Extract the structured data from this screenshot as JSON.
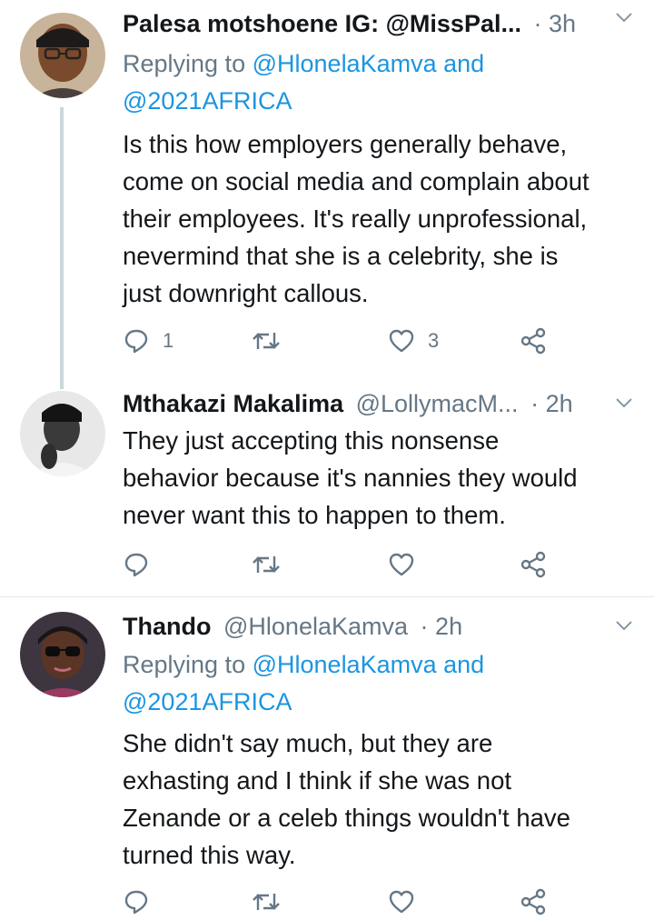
{
  "tweets": [
    {
      "name": "Palesa motshoene IG: @MissPal...",
      "handle": "",
      "separator": "·",
      "time": "3h",
      "replying_prefix": "Replying to",
      "replying_first": "@HlonelaKamva",
      "replying_and": "and",
      "replying_second": "@2021AFRICA",
      "text_lines": [
        "Is this how employers generally behave,",
        "come on social media and complain about",
        "their employees. It's really unprofessional,",
        "nevermind that she is a celebrity, she is",
        "just downright callous."
      ],
      "reply_count": "1",
      "retweet_count": "",
      "like_count": "3"
    },
    {
      "name": "Mthakazi Makalima",
      "handle": "@LollymacM...",
      "separator": "·",
      "time": "2h",
      "text_lines": [
        "They just accepting this nonsense",
        "behavior because it's nannies they would",
        "never want this to happen to them."
      ],
      "reply_count": "",
      "retweet_count": "",
      "like_count": ""
    },
    {
      "name": "Thando",
      "handle": "@HlonelaKamva",
      "separator": "·",
      "time": "2h",
      "replying_prefix": "Replying to",
      "replying_first": "@HlonelaKamva",
      "replying_and": "and",
      "replying_second": "@2021AFRICA",
      "text_lines": [
        "She didn't say much, but they are",
        "exhasting and I think if she was not",
        "Zenande or a celeb things wouldn't have",
        "turned this way."
      ],
      "reply_count": "",
      "retweet_count": "",
      "like_count": ""
    }
  ],
  "icons": {
    "reply": "reply-icon",
    "retweet": "retweet-icon",
    "like": "heart-icon",
    "share": "share-icon",
    "caret": "chevron-down-icon"
  },
  "colors": {
    "link": "#1b95e0",
    "secondary_text": "#657786",
    "primary_text": "#14171a",
    "thread_line": "#ccd6dd",
    "divider": "#e1e8ed"
  }
}
